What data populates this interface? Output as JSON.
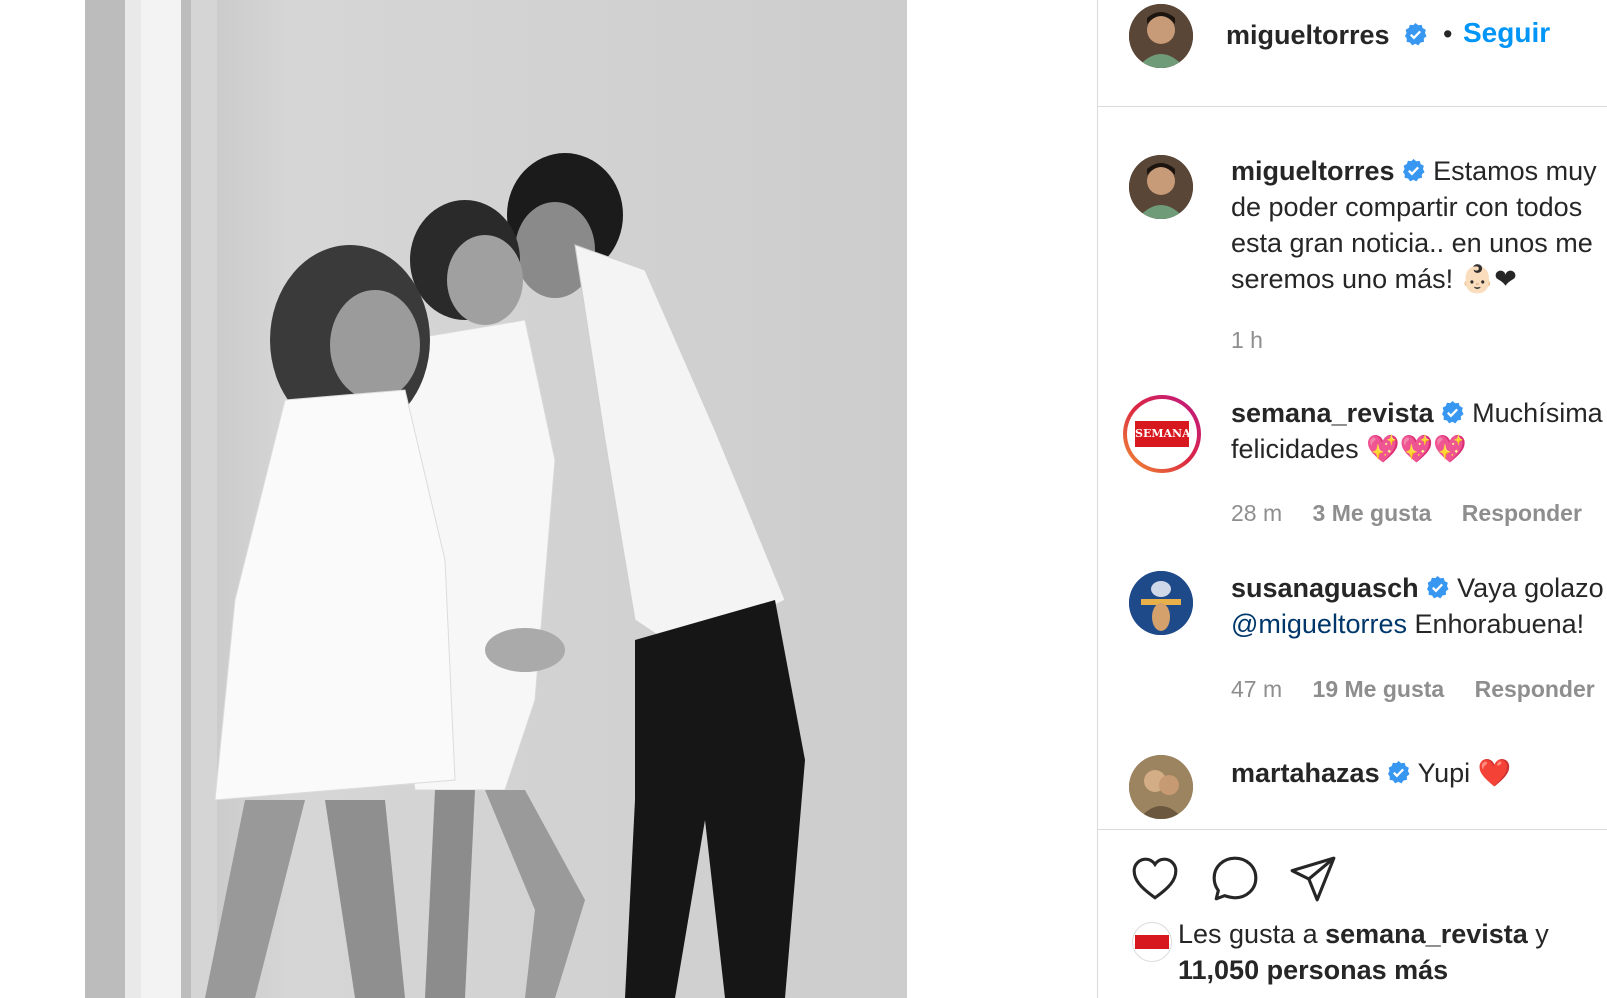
{
  "header": {
    "username": "migueltorres",
    "dot": "•",
    "follow_label": "Seguir"
  },
  "caption": {
    "username": "migueltorres",
    "lines": [
      "Estamos muy",
      "de poder compartir con todos",
      "esta gran noticia.. en unos me",
      "seremos uno más! 👶🏻❤"
    ],
    "time": "1 h"
  },
  "comments": [
    {
      "username": "semana_revista",
      "lines": [
        "Muchísima",
        "felicidades 💖💖💖"
      ],
      "time": "28 m",
      "likes": "3 Me gusta",
      "reply": "Responder"
    },
    {
      "username": "susanaguasch",
      "lines": [
        "Vaya golazo",
        "Enhorabuena!"
      ],
      "mention": "@migueltorres",
      "time": "47 m",
      "likes": "19 Me gusta",
      "reply": "Responder"
    },
    {
      "username": "martahazas",
      "lines": [
        "Yupi ❤️"
      ]
    }
  ],
  "likes": {
    "prefix": "Les gusta a ",
    "user": "semana_revista",
    "suffix": " y",
    "count": "11,050 personas más"
  },
  "avatar_labels": {
    "semana": "SEMANA"
  },
  "colors": {
    "link": "#0095f6",
    "verified": "#3897f0",
    "muted": "#8e8e8e",
    "border": "#dbdbdb"
  }
}
